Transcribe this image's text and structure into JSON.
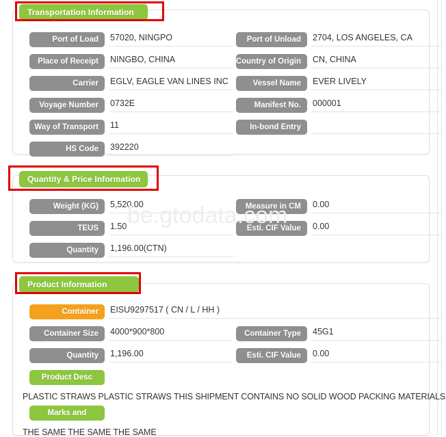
{
  "watermark": "be.gtodata.com",
  "sections": {
    "transportation": {
      "title": "Transportation Information",
      "left_fields": [
        {
          "label": "Port of Load",
          "value": "57020, NINGPO"
        },
        {
          "label": "Place of Receipt",
          "value": "NINGBO, CHINA"
        },
        {
          "label": "Carrier",
          "value": "EGLV, EAGLE VAN LINES INC"
        },
        {
          "label": "Voyage Number",
          "value": "0732E"
        },
        {
          "label": "Way of Transport",
          "value": "11"
        },
        {
          "label": "HS Code",
          "value": "392220"
        }
      ],
      "right_fields": [
        {
          "label": "Port of Unload",
          "value": "2704, LOS ANGELES, CA"
        },
        {
          "label": "Country of Origin",
          "value": "CN, CHINA"
        },
        {
          "label": "Vessel Name",
          "value": "EVER LIVELY"
        },
        {
          "label": "Manifest No.",
          "value": "000001"
        },
        {
          "label": "In-bond Entry",
          "value": ""
        }
      ]
    },
    "quantity": {
      "title": "Quantity & Price Information",
      "left_fields": [
        {
          "label": "Weight (KG)",
          "value": "5,520.00"
        },
        {
          "label": "TEUS",
          "value": "1.50"
        },
        {
          "label": "Quantity",
          "value": "1,196.00(CTN)"
        }
      ],
      "right_fields": [
        {
          "label": "Measure in CM",
          "value": "0.00"
        },
        {
          "label": "Esti. CIF Value",
          "value": "0.00"
        }
      ]
    },
    "product": {
      "title": "Product Information",
      "container": {
        "label": "Container",
        "value": "EISU9297517 ( CN / L / HH )"
      },
      "left_fields": [
        {
          "label": "Container Size",
          "value": "4000*900*800"
        },
        {
          "label": "Quantity",
          "value": "1,196.00"
        }
      ],
      "right_fields": [
        {
          "label": "Container Type",
          "value": "45G1"
        },
        {
          "label": "Esti. CIF Value",
          "value": "0.00"
        }
      ],
      "product_desc": {
        "label": "Product Desc",
        "text": "PLASTIC STRAWS PLASTIC STRAWS THIS SHIPMENT CONTAINS NO SOLID WOOD PACKING MATERIALS."
      },
      "marks": {
        "label": "Marks and",
        "text": "THE SAME THE SAME THE SAME"
      }
    }
  },
  "colors": {
    "section_green": "#8dc63f",
    "label_gray": "#908f8f",
    "container_orange": "#f5a11c",
    "annotation_red": "#e00000"
  }
}
